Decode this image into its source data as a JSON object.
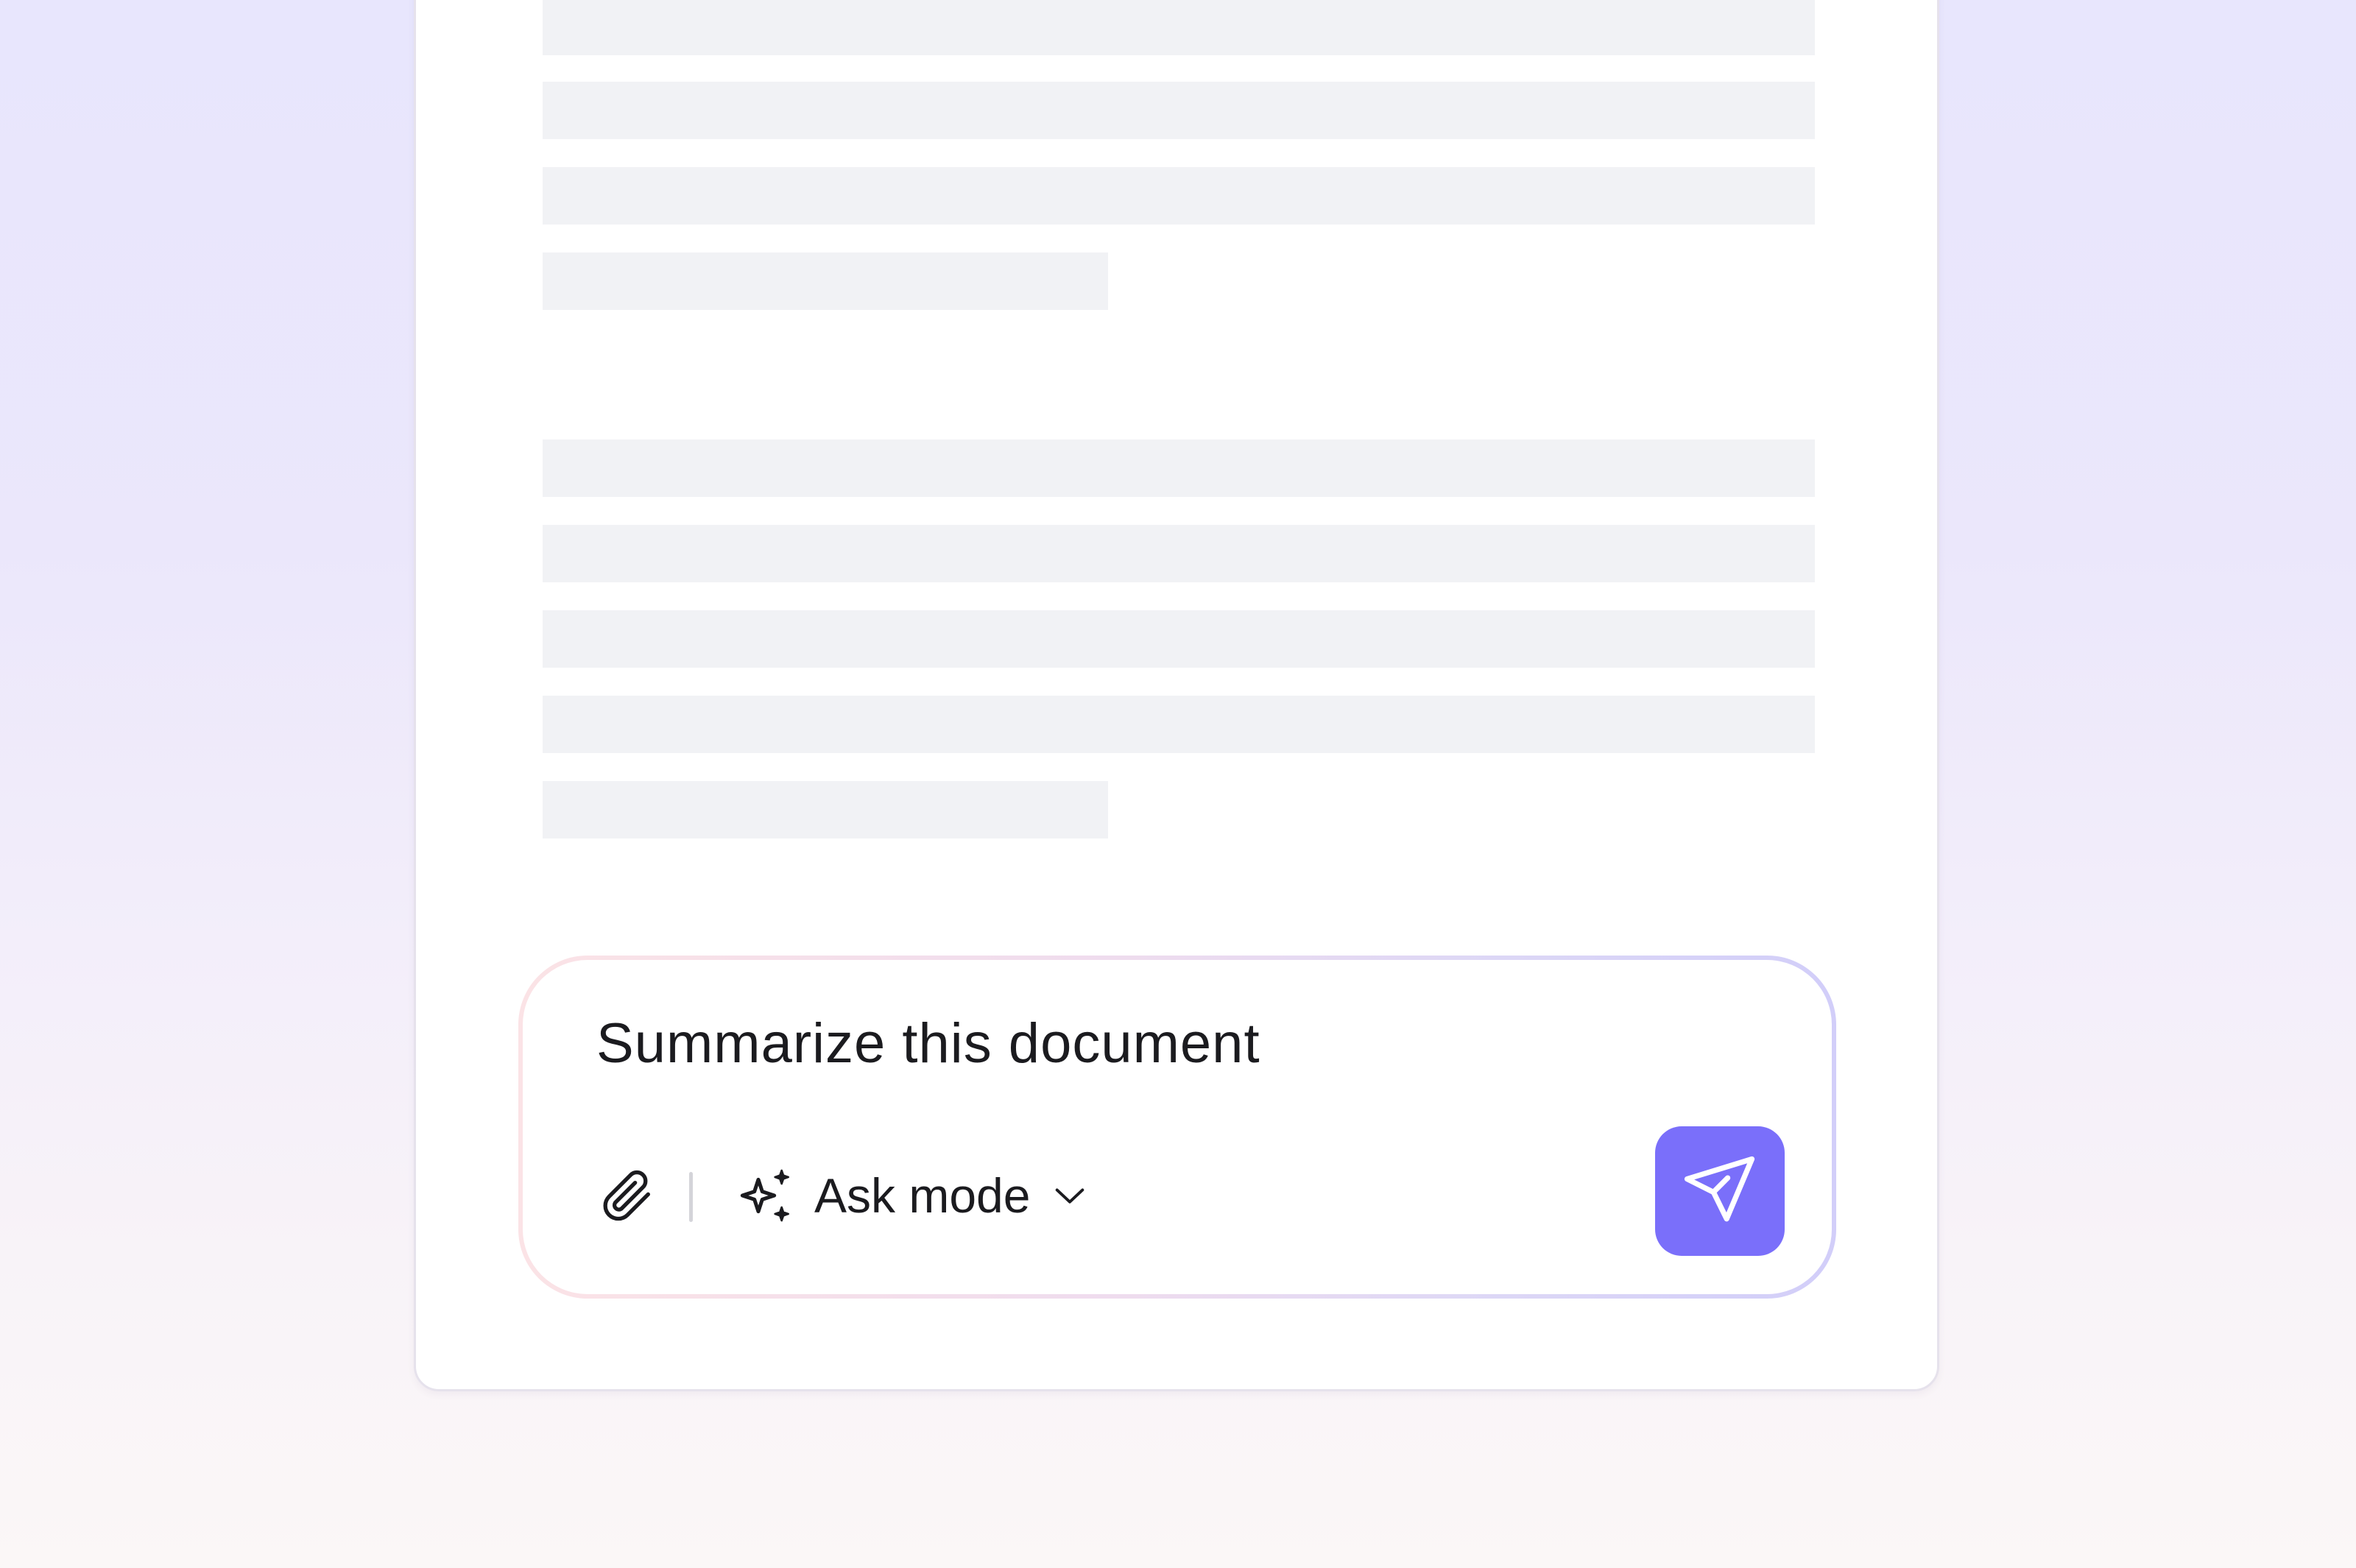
{
  "composer": {
    "prompt_text": "Summarize this document",
    "mode_label": "Ask mode",
    "send_color": "#7a6ffa"
  },
  "icons": {
    "attach": "paperclip-icon",
    "mode": "sparkle-icon",
    "dropdown": "chevron-down-icon",
    "send": "paper-plane-icon"
  }
}
